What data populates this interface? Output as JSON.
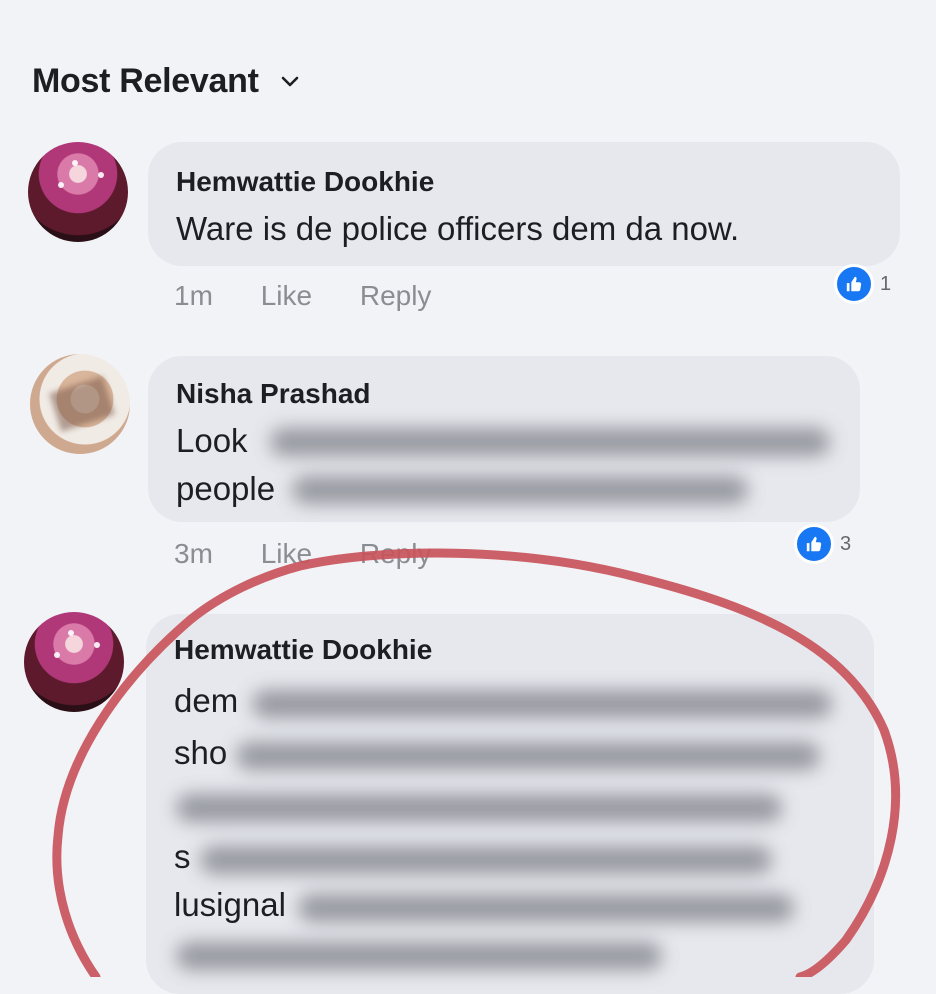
{
  "sort": {
    "label": "Most Relevant",
    "icon": "chevron-down-icon"
  },
  "comments": [
    {
      "author": "Hemwattie Dookhie",
      "text": "Ware is de police officers dem da now.",
      "time": "1m",
      "like_label": "Like",
      "reply_label": "Reply",
      "reaction_icon": "like-icon",
      "reaction_count": "1"
    },
    {
      "author": "Nisha Prashad",
      "text_line1": "Look",
      "text_line2": "people",
      "time": "3m",
      "like_label": "Like",
      "reply_label": "Reply",
      "reaction_icon": "like-icon",
      "reaction_count": "3"
    },
    {
      "author": "Hemwattie Dookhie",
      "text_lines": [
        "dem",
        "sho",
        "",
        "s",
        "lusignal",
        ""
      ]
    }
  ],
  "colors": {
    "accent": "#1877f2",
    "annotation": "#c9545b",
    "bubble": "#e6e8ee",
    "meta": "#8a8d91"
  }
}
